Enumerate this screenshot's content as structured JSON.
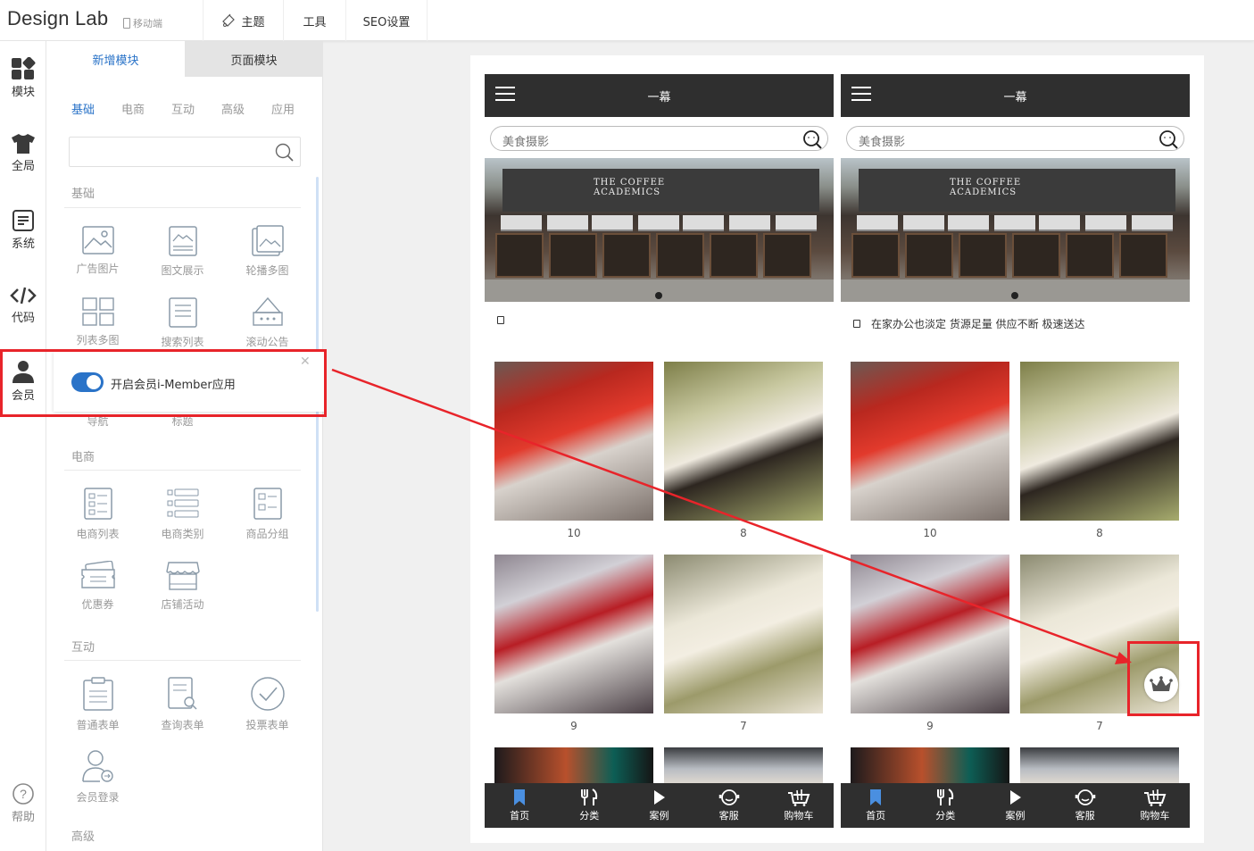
{
  "app": {
    "logo": "Design Lab",
    "mobile_label": "移动端"
  },
  "top_menu": [
    {
      "label": "主题",
      "icon": "theme-icon"
    },
    {
      "label": "工具",
      "icon": ""
    },
    {
      "label": "SEO设置",
      "icon": ""
    }
  ],
  "rail": [
    {
      "label": "模块",
      "icon": "modules-icon"
    },
    {
      "label": "全局",
      "icon": "shirt-icon"
    },
    {
      "label": "系统",
      "icon": "system-icon"
    },
    {
      "label": "代码",
      "icon": "code-icon"
    },
    {
      "label": "会员",
      "icon": "member-icon"
    },
    {
      "label": "帮助",
      "icon": "help-icon"
    }
  ],
  "panel": {
    "tab_add": "新增模块",
    "tab_page": "页面模块",
    "categories": [
      "基础",
      "电商",
      "互动",
      "高级",
      "应用"
    ],
    "search_placeholder": "",
    "sections": {
      "basic": "基础",
      "ecommerce": "电商",
      "interactive": "互动",
      "advanced": "高级"
    },
    "basic_modules": [
      "广告图片",
      "图文展示",
      "轮播多图",
      "列表多图",
      "搜索列表",
      "滚动公告"
    ],
    "hidden_row": [
      "导航",
      "标题"
    ],
    "ecommerce_modules": [
      "电商列表",
      "电商类别",
      "商品分组",
      "优惠券",
      "店铺活动"
    ],
    "interactive_modules": [
      "普通表单",
      "查询表单",
      "投票表单",
      "会员登录"
    ]
  },
  "popup": {
    "toggle_on": true,
    "label": "开启会员i-Member应用",
    "close": "✕"
  },
  "phones": [
    {
      "title": "一幕",
      "search_placeholder": "美食摄影",
      "banner_sign_1": "THE COFFEE",
      "banner_sign_2": "ACADEMICS",
      "notice": "",
      "numbers": [
        "10",
        "8",
        "9",
        "7"
      ],
      "show_crown": false
    },
    {
      "title": "一幕",
      "search_placeholder": "美食摄影",
      "banner_sign_1": "THE COFFEE",
      "banner_sign_2": "ACADEMICS",
      "notice": "在家办公也淡定 货源足量 供应不断 极速送达",
      "numbers": [
        "10",
        "8",
        "9",
        "7"
      ],
      "show_crown": true
    }
  ],
  "bottom_nav": [
    "首页",
    "分类",
    "案例",
    "客服",
    "购物车"
  ],
  "colors": {
    "accent": "#2a73c8",
    "highlight": "#e8242a",
    "phone_bar": "#2f2f2f"
  }
}
